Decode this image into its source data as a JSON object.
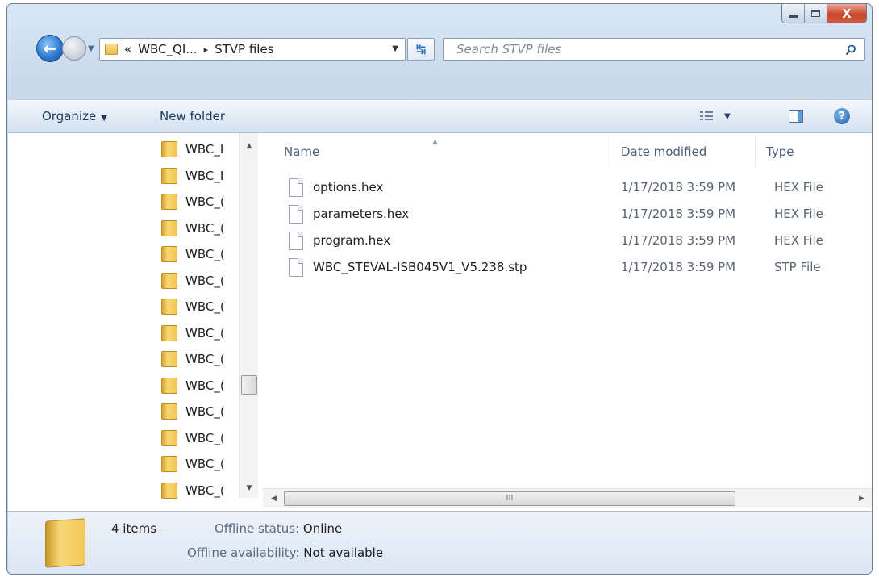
{
  "window": {
    "close_glyph": "X"
  },
  "address": {
    "overflow": "«",
    "crumbs": [
      "WBC_QI...",
      "STVP files"
    ],
    "separator": "▸"
  },
  "search": {
    "placeholder": "Search STVP files"
  },
  "toolbar": {
    "organize": "Organize",
    "new_folder": "New folder"
  },
  "nav_tree": {
    "items": [
      "WBC_I",
      "WBC_I",
      "WBC_(",
      "WBC_(",
      "WBC_(",
      "WBC_(",
      "WBC_(",
      "WBC_(",
      "WBC_(",
      "WBC_(",
      "WBC_(",
      "WBC_(",
      "WBC_(",
      "WBC_("
    ]
  },
  "columns": {
    "name": "Name",
    "date": "Date modified",
    "type": "Type"
  },
  "files": [
    {
      "name": "options.hex",
      "date": "1/17/2018 3:59 PM",
      "type": "HEX File"
    },
    {
      "name": "parameters.hex",
      "date": "1/17/2018 3:59 PM",
      "type": "HEX File"
    },
    {
      "name": "program.hex",
      "date": "1/17/2018 3:59 PM",
      "type": "HEX File"
    },
    {
      "name": "WBC_STEVAL-ISB045V1_V5.238.stp",
      "date": "1/17/2018 3:59 PM",
      "type": "STP File"
    }
  ],
  "details": {
    "count": "4 items",
    "offline_status_label": "Offline status:",
    "offline_status_value": "Online",
    "offline_avail_label": "Offline availability:",
    "offline_avail_value": "Not available"
  },
  "hscroll_grip": "III",
  "help_glyph": "?",
  "icons": {
    "back": "arrow-left-icon",
    "forward": "arrow-right-icon",
    "refresh": "refresh-icon",
    "search": "search-icon",
    "folder": "folder-icon",
    "file": "file-icon",
    "views": "views-icon",
    "preview_pane": "preview-pane-icon",
    "help": "help-icon"
  }
}
